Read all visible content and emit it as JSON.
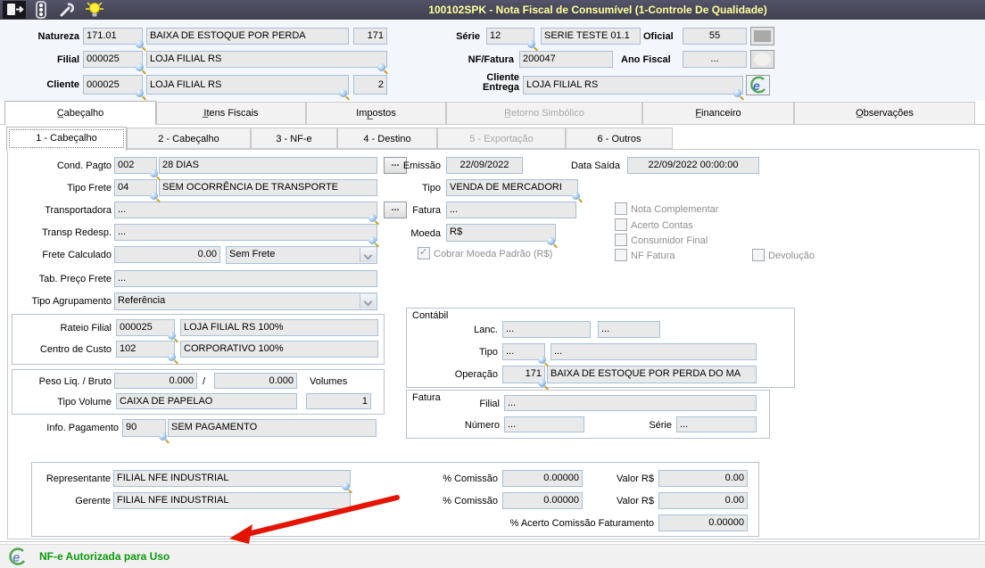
{
  "titlebar": {
    "title": "100102SPK - Nota Fiscal de Consumível (1-Controle De Qualidade)",
    "icons": [
      {
        "name": "exit-icon"
      },
      {
        "name": "traffic-light-icon"
      },
      {
        "name": "wrench-icon"
      },
      {
        "name": "bulb-icon"
      }
    ]
  },
  "header": {
    "natureza": {
      "label": "Natureza",
      "code": "171.01",
      "desc": "BAIXA DE ESTOQUE POR PERDA",
      "extra": "171"
    },
    "filial": {
      "label": "Filial",
      "code": "000025",
      "desc": "LOJA FILIAL RS"
    },
    "cliente": {
      "label": "Cliente",
      "code": "000025",
      "desc": "LOJA FILIAL RS",
      "extra": "2"
    },
    "serie": {
      "label": "Série",
      "code": "12",
      "desc": "SERIE TESTE 01.1"
    },
    "oficial": {
      "label": "Oficial",
      "value": "55"
    },
    "nf_fatura": {
      "label": "NF/Fatura",
      "value": "200047"
    },
    "ano_fiscal": {
      "label": "Ano Fiscal",
      "value": "..."
    },
    "cliente_entrega": {
      "label": "Cliente Entrega",
      "value": "LOJA FILIAL RS"
    }
  },
  "tabs": {
    "main": [
      {
        "label": "C̲abeçalho",
        "state": "active"
      },
      {
        "label": "I̲tens Fiscais",
        "state": "normal"
      },
      {
        "label": "Imp̲ostos",
        "state": "normal"
      },
      {
        "label": "R̲etorno Simbólico",
        "state": "disabled"
      },
      {
        "label": "F̲inanceiro",
        "state": "normal"
      },
      {
        "label": "O̲bservações",
        "state": "normal"
      }
    ],
    "sub": [
      {
        "label": "1 - Cabeçalho",
        "state": "active"
      },
      {
        "label": "2 - Cabeçalho",
        "state": "normal"
      },
      {
        "label": "3 - NF-e",
        "state": "normal"
      },
      {
        "label": "4 - Destino",
        "state": "normal"
      },
      {
        "label": "5 - Exportação",
        "state": "disabled"
      },
      {
        "label": "6 - Outros",
        "state": "normal"
      }
    ]
  },
  "buttons": {
    "dots": "..."
  },
  "form": {
    "cond_pagto": {
      "label": "Cond. Pagto",
      "code": "002",
      "desc": "28 DIAS"
    },
    "tipo_frete": {
      "label": "Tipo Frete",
      "code": "04",
      "desc": "SEM OCORRÊNCIA DE TRANSPORTE"
    },
    "transportadora": {
      "label": "Transportadora",
      "value": "..."
    },
    "transp_redesp": {
      "label": "Transp Redesp.",
      "value": "..."
    },
    "frete_calculado": {
      "label": "Frete Calculado",
      "value": "0.00",
      "option": "Sem Frete"
    },
    "tab_preco_frete": {
      "label": "Tab. Preço Frete",
      "value": "..."
    },
    "tipo_agrupamento": {
      "label": "Tipo Agrupamento",
      "option": "Referência"
    },
    "rateio": {
      "label": "Rateio  Filial",
      "code": "000025",
      "desc": "LOJA FILIAL RS 100%"
    },
    "centro_custo": {
      "label": "Centro de Custo",
      "code": "102",
      "desc": "CORPORATIVO 100%"
    },
    "peso": {
      "label": "Peso Liq. / Bruto",
      "liq": "0.000",
      "sep": "/",
      "bruto": "0.000",
      "volumes_label": "Volumes"
    },
    "tipo_volume": {
      "label": "Tipo Volume",
      "desc": "CAIXA DE PAPELAO",
      "qty": "1"
    },
    "info_pagamento": {
      "label": "Info. Pagamento",
      "code": "90",
      "desc": "SEM PAGAMENTO"
    },
    "emissao": {
      "label": "Emissão",
      "value": "22/09/2022"
    },
    "data_saida": {
      "label": "Data Saída",
      "value": "22/09/2022 00:00:00"
    },
    "tipo": {
      "label": "Tipo",
      "value": "VENDA DE MERCADORI"
    },
    "fatura": {
      "label": "Fatura",
      "value": "..."
    },
    "moeda": {
      "label": "Moeda",
      "value": "R$"
    },
    "cobrar_moeda": {
      "label": "Cobrar Moeda Padrão (R$)",
      "checked": true
    },
    "flags": [
      {
        "label": "Nota Complementar",
        "checked": false
      },
      {
        "label": "Acerto Contas",
        "checked": false
      },
      {
        "label": "Consumidor Final",
        "checked": false
      },
      {
        "label": "NF Fatura",
        "checked": false
      },
      {
        "label": "Devolução",
        "checked": false
      }
    ],
    "contabil": {
      "title": "Contábil",
      "lanc": {
        "label": "Lanc.",
        "v1": "...",
        "v2": "..."
      },
      "tipo": {
        "label": "Tipo",
        "code": "...",
        "desc": "..."
      },
      "operacao": {
        "label": "Operação",
        "code": "171",
        "desc": "BAIXA DE ESTOQUE POR PERDA DO MA"
      }
    },
    "fatura_group": {
      "title": "Fatura",
      "filial": {
        "label": "Filial",
        "value": "..."
      },
      "numero": {
        "label": "Número",
        "value": "..."
      },
      "serie": {
        "label": "Série",
        "value": "..."
      }
    },
    "comissao": {
      "representante": {
        "label": "Representante",
        "value": "FILIAL NFE INDUSTRIAL"
      },
      "gerente": {
        "label": "Gerente",
        "value": "FILIAL NFE INDUSTRIAL"
      },
      "pct1": {
        "label": "% Comissão",
        "value": "0.00000"
      },
      "valor1": {
        "label": "Valor R$",
        "value": "0.00"
      },
      "pct2": {
        "label": "% Comissão",
        "value": "0.00000"
      },
      "valor2": {
        "label": "Valor R$",
        "value": "0.00"
      },
      "acerto": {
        "label": "% Acerto Comissão Faturamento",
        "value": "0.00000"
      }
    }
  },
  "statusbar": {
    "message": "NF-e Autorizada para Uso",
    "icon": "nfe-logo-icon"
  },
  "colors": {
    "title_bg": "#47475a",
    "title_text": "#ffff9c",
    "field_bg": "#e9e9e9",
    "field_border": "#a7c0da",
    "status_green": "#0a9a0a",
    "arrow_red": "#e51400"
  }
}
